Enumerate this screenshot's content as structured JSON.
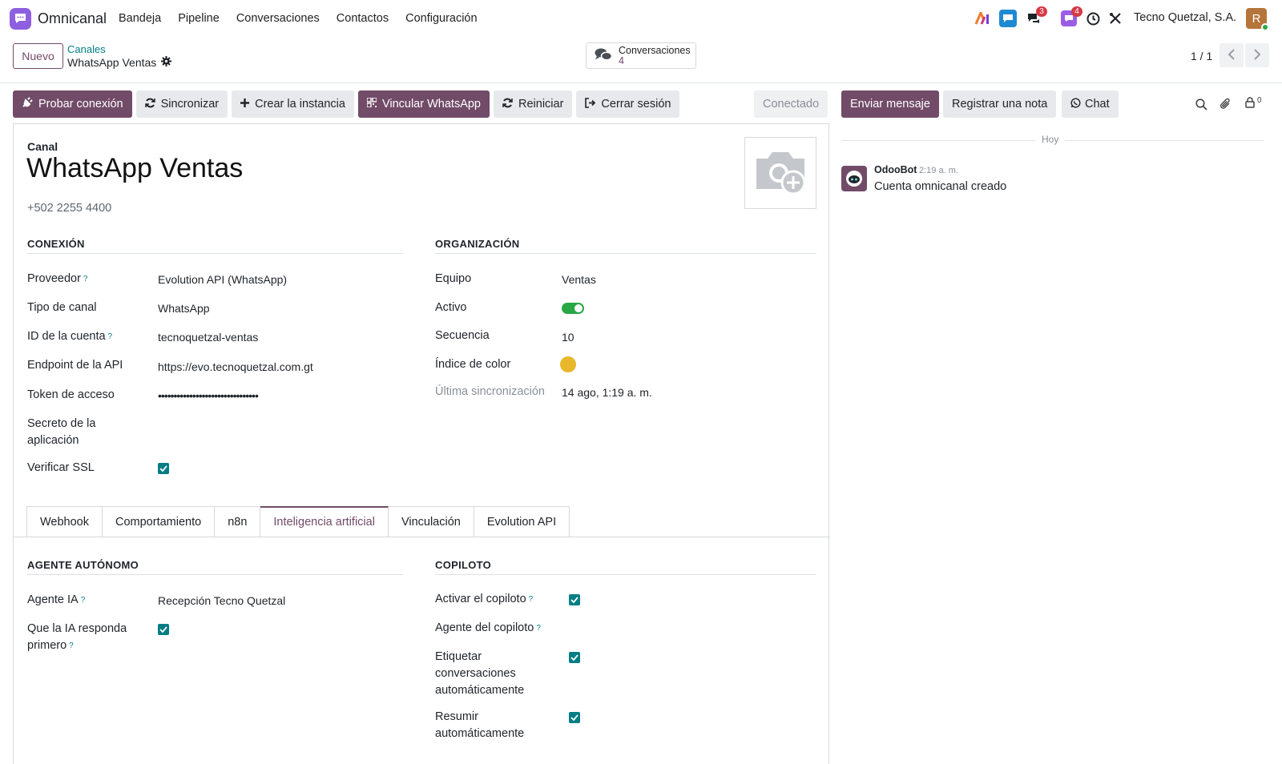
{
  "app": {
    "name": "Omnicanal"
  },
  "menu": [
    "Bandeja",
    "Pipeline",
    "Conversaciones",
    "Contactos",
    "Configuración"
  ],
  "systray": {
    "messages_count": "3",
    "activity_count": "4",
    "company": "Tecno Quetzal, S.A.",
    "avatar_initial": "R"
  },
  "control_panel": {
    "new_label": "Nuevo",
    "breadcrumb_parent": "Canales",
    "breadcrumb_current": "WhatsApp Ventas",
    "smart_button_label": "Conversaciones",
    "smart_button_count": "4",
    "pager": "1 / 1"
  },
  "actions": [
    "Probar conexión",
    "Sincronizar",
    "Crear la instancia",
    "Vincular WhatsApp",
    "Reiniciar",
    "Cerrar sesión"
  ],
  "status": "Conectado",
  "form": {
    "title_label": "Canal",
    "name": "WhatsApp Ventas",
    "phone": "+502 2255 4400",
    "connection": {
      "heading": "CONEXIÓN",
      "provider_label": "Proveedor",
      "provider": "Evolution API (WhatsApp)",
      "channel_type_label": "Tipo de canal",
      "channel_type": "WhatsApp",
      "account_id_label": "ID de la cuenta",
      "account_id": "tecnoquetzal-ventas",
      "endpoint_label": "Endpoint de la API",
      "endpoint": "https://evo.tecnoquetzal.com.gt",
      "token_label": "Token de acceso",
      "token": "••••••••••••••••••••••••••••••••",
      "secret_label_1": "Secreto de la",
      "secret_label_2": "aplicación",
      "ssl_label": "Verificar SSL"
    },
    "organization": {
      "heading": "ORGANIZACIÓN",
      "team_label": "Equipo",
      "team": "Ventas",
      "active_label": "Activo",
      "sequence_label": "Secuencia",
      "sequence": "10",
      "color_label": "Índice de color",
      "color": "#e8b82a",
      "last_sync_label": "Última sincronización",
      "last_sync": "14 ago, 1:19 a. m."
    },
    "tabs": [
      "Webhook",
      "Comportamiento",
      "n8n",
      "Inteligencia artificial",
      "Vinculación",
      "Evolution API"
    ],
    "active_tab": "Inteligencia artificial",
    "ai": {
      "agent_heading": "AGENTE AUTÓNOMO",
      "agent_label": "Agente IA",
      "agent": "Recepción Tecno Quetzal",
      "ai_first_label_1": "Que la IA responda",
      "ai_first_label_2": "primero",
      "copilot_heading": "COPILOTO",
      "copilot_enable_label": "Activar el copiloto",
      "copilot_agent_label": "Agente del copiloto",
      "tag_label_1": "Etiquetar",
      "tag_label_2": "conversaciones",
      "tag_label_3": "automáticamente",
      "summary_label_1": "Resumir",
      "summary_label_2": "automáticamente"
    }
  },
  "chatter": {
    "send_label": "Enviar mensaje",
    "note_label": "Registrar una nota",
    "chat_label": "Chat",
    "followers_count": "0",
    "today_label": "Hoy",
    "message": {
      "author": "OdooBot",
      "time": "2:19 a. m.",
      "body": "Cuenta omnicanal creado"
    }
  },
  "colors": {
    "primary": "#714b67",
    "accent": "#017e84",
    "toggle_on": "#28a745"
  }
}
